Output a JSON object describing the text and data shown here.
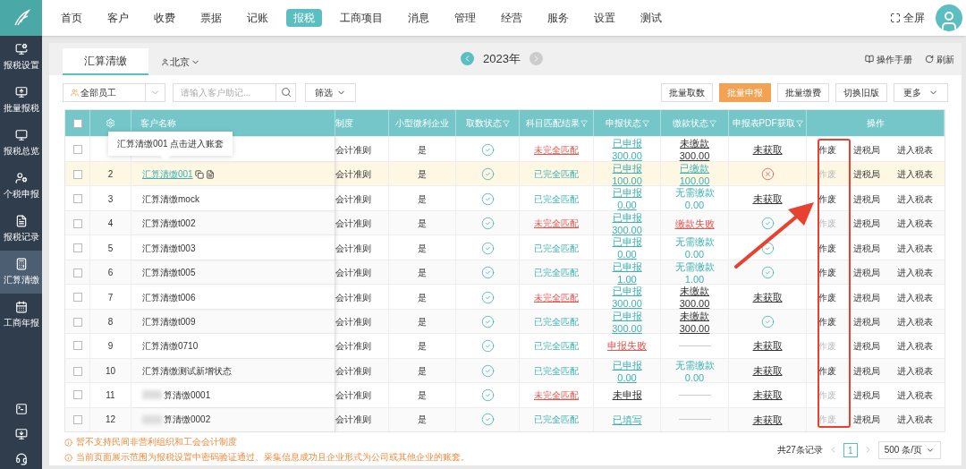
{
  "nav": {
    "items": [
      {
        "label": "首页",
        "selected": false
      },
      {
        "label": "客户",
        "selected": false
      },
      {
        "label": "收费",
        "selected": false
      },
      {
        "label": "票据",
        "selected": false
      },
      {
        "label": "记账",
        "selected": false
      },
      {
        "label": "报税",
        "selected": true
      },
      {
        "label": "工商项目",
        "selected": false
      },
      {
        "label": "消息",
        "selected": false
      },
      {
        "label": "管理",
        "selected": false
      },
      {
        "label": "经营",
        "selected": false
      },
      {
        "label": "服务",
        "selected": false
      },
      {
        "label": "设置",
        "selected": false
      },
      {
        "label": "测试",
        "selected": false
      }
    ],
    "fullscreen": "全屏"
  },
  "sidebar": {
    "items": [
      {
        "label": "报税设置",
        "selected": false
      },
      {
        "label": "批量报税",
        "selected": false
      },
      {
        "label": "报税总览",
        "selected": false
      },
      {
        "label": "个税申报",
        "selected": false
      },
      {
        "label": "报税记录",
        "selected": false
      },
      {
        "label": "汇算清缴",
        "selected": true
      },
      {
        "label": "工商年报",
        "selected": false
      }
    ]
  },
  "tabs": [
    {
      "label": "汇算清缴",
      "selected": true
    }
  ],
  "region": "北京",
  "year": "2023年",
  "links": [
    "操作手册",
    "刷新"
  ],
  "toolbar": {
    "staff": "全部员工",
    "search_placeholder": "请输入客户助记...",
    "filter": "筛选",
    "buttons": [
      {
        "label": "批量取数",
        "kind": "default"
      },
      {
        "label": "批量申报",
        "kind": "primary"
      },
      {
        "label": "批量缴费",
        "kind": "default"
      },
      {
        "label": "切换旧版",
        "kind": "default"
      },
      {
        "label": "更多",
        "kind": "menu"
      }
    ]
  },
  "table": {
    "columns": [
      "客户名称",
      "制度",
      "小型微利企业",
      "取数状态",
      "科目匹配结果",
      "申报状态",
      "缴款状态",
      "申报表PDF获取",
      "操作"
    ],
    "tooltip": "汇算清缴001 点击进入账套",
    "select_all_checked": false,
    "rows": [
      {
        "index": "",
        "name": "",
        "system": "会计准则",
        "small": "是",
        "match": {
          "text": "未完全匹配",
          "kind": "partial"
        },
        "declare": {
          "kind": "link",
          "text": "已申报",
          "amount": "300.00"
        },
        "pay": {
          "kind": "dark",
          "text": "未缴款",
          "amount": "300.00"
        },
        "pdf": {
          "kind": "text",
          "text": "未获取"
        },
        "actions": {
          "void": "作废",
          "void_disabled": false,
          "bureau": "进税局",
          "form": "进入税表"
        },
        "highlighted": false
      },
      {
        "index": "2",
        "name": "汇算清缴001",
        "system": "会计准则",
        "small": "是",
        "match": {
          "text": "已完全匹配",
          "kind": "full"
        },
        "declare": {
          "kind": "link",
          "text": "已申报",
          "amount": "100.00"
        },
        "pay": {
          "kind": "link",
          "text": "已缴款",
          "amount": "100.00"
        },
        "pdf": {
          "kind": "error"
        },
        "actions": {
          "void": "作废",
          "void_disabled": true,
          "bureau": "进税局",
          "form": "进入税表"
        },
        "highlighted": true,
        "masked": false
      },
      {
        "index": "3",
        "name": "汇算清缴mock",
        "system": "会计准则",
        "small": "是",
        "match": {
          "text": "已完全匹配",
          "kind": "full"
        },
        "declare": {
          "kind": "link",
          "text": "已申报",
          "amount": "0.00"
        },
        "pay": {
          "kind": "plain",
          "text": "无需缴款",
          "amount": "0.00"
        },
        "pdf": {
          "kind": "text",
          "text": "未获取"
        },
        "actions": {
          "void": "作废",
          "void_disabled": false,
          "bureau": "进税局",
          "form": "进入税表"
        },
        "highlighted": false,
        "masked": false
      },
      {
        "index": "4",
        "name": "汇算清缴t002",
        "system": "会计准则",
        "small": "是",
        "match": {
          "text": "未完全匹配",
          "kind": "partial"
        },
        "declare": {
          "kind": "link",
          "text": "已申报",
          "amount": "300.00"
        },
        "pay": {
          "kind": "danger",
          "text": "缴款失败"
        },
        "pdf": {
          "kind": "check"
        },
        "actions": {
          "void": "作废",
          "void_disabled": true,
          "bureau": "进税局",
          "form": "进入税表"
        },
        "highlighted": false,
        "masked": false
      },
      {
        "index": "5",
        "name": "汇算清缴t003",
        "system": "会计准则",
        "small": "是",
        "match": {
          "text": "已完全匹配",
          "kind": "full"
        },
        "declare": {
          "kind": "link",
          "text": "已申报",
          "amount": "0.00"
        },
        "pay": {
          "kind": "plain",
          "text": "无需缴款",
          "amount": "0.00"
        },
        "pdf": {
          "kind": "check"
        },
        "actions": {
          "void": "作废",
          "void_disabled": false,
          "bureau": "进税局",
          "form": "进入税表"
        },
        "highlighted": false,
        "masked": false
      },
      {
        "index": "6",
        "name": "汇算清缴t005",
        "system": "会计准则",
        "small": "是",
        "match": {
          "text": "已完全匹配",
          "kind": "full"
        },
        "declare": {
          "kind": "link",
          "text": "已申报",
          "amount": "1.00"
        },
        "pay": {
          "kind": "plain",
          "text": "无需缴款",
          "amount": "1.00"
        },
        "pdf": {
          "kind": "check"
        },
        "actions": {
          "void": "作废",
          "void_disabled": false,
          "bureau": "进税局",
          "form": "进入税表"
        },
        "highlighted": false,
        "masked": false
      },
      {
        "index": "7",
        "name": "汇算清缴t006",
        "system": "会计准则",
        "small": "是",
        "match": {
          "text": "未完全匹配",
          "kind": "partial"
        },
        "declare": {
          "kind": "link",
          "text": "已申报",
          "amount": "300.00"
        },
        "pay": {
          "kind": "dark",
          "text": "未缴款",
          "amount": "300.00"
        },
        "pdf": {
          "kind": "text",
          "text": "未获取"
        },
        "actions": {
          "void": "作废",
          "void_disabled": false,
          "bureau": "进税局",
          "form": "进入税表"
        },
        "highlighted": false,
        "masked": false
      },
      {
        "index": "8",
        "name": "汇算清缴t009",
        "system": "会计准则",
        "small": "是",
        "match": {
          "text": "已完全匹配",
          "kind": "full"
        },
        "declare": {
          "kind": "link",
          "text": "已申报",
          "amount": "300.00"
        },
        "pay": {
          "kind": "dark",
          "text": "未缴款",
          "amount": "300.00"
        },
        "pdf": {
          "kind": "check"
        },
        "actions": {
          "void": "作废",
          "void_disabled": false,
          "bureau": "进税局",
          "form": "进入税表"
        },
        "highlighted": false,
        "masked": false
      },
      {
        "index": "9",
        "name": "汇算清缴0710",
        "system": "会计准则",
        "small": "是",
        "match": {
          "text": "已完全匹配",
          "kind": "full"
        },
        "declare": {
          "kind": "danger",
          "text": "申报失败"
        },
        "pay": {
          "kind": "none"
        },
        "pdf": {
          "kind": "text",
          "text": "未获取"
        },
        "actions": {
          "void": "作废",
          "void_disabled": true,
          "bureau": "进税局",
          "form": "进入税表"
        },
        "highlighted": false,
        "masked": false
      },
      {
        "index": "10",
        "name": "汇算清缴测试新增状态",
        "system": "会计准则",
        "small": "是",
        "match": {
          "text": "已完全匹配",
          "kind": "full"
        },
        "declare": {
          "kind": "link",
          "text": "已申报",
          "amount": "0.00"
        },
        "pay": {
          "kind": "plain",
          "text": "无需缴款",
          "amount": "0.00"
        },
        "pdf": {
          "kind": "text",
          "text": "未获取"
        },
        "actions": {
          "void": "作废",
          "void_disabled": false,
          "bureau": "进税局",
          "form": "进入税表"
        },
        "highlighted": false,
        "masked": false
      },
      {
        "index": "11",
        "name": "算清缴0001",
        "system": "会计准则",
        "small": "是",
        "match": {
          "text": "未完全匹配",
          "kind": "partial"
        },
        "declare": {
          "kind": "dark",
          "text": "未申报"
        },
        "pay": {
          "kind": "none"
        },
        "pdf": {
          "kind": "text",
          "text": "未获取"
        },
        "actions": {
          "void": "作废",
          "void_disabled": true,
          "bureau": "进税局",
          "form": "进入税表"
        },
        "highlighted": false,
        "masked": true
      },
      {
        "index": "12",
        "name": "算清缴0002",
        "system": "会计准则",
        "small": "是",
        "match": {
          "text": "已完全匹配",
          "kind": "full"
        },
        "declare": {
          "kind": "link",
          "text": "已填写"
        },
        "pay": {
          "kind": "none"
        },
        "pdf": {
          "kind": "text",
          "text": "未获取"
        },
        "actions": {
          "void": "作废",
          "void_disabled": true,
          "bureau": "进税局",
          "form": "进入税表"
        },
        "highlighted": false,
        "masked": true
      }
    ]
  },
  "notes": [
    "暂不支持民间非营利组织和工会会计制度",
    "当前页面展示范围为报税设置中密码验证通过、采集信息成功且企业形式为公司或其他企业的账套。"
  ],
  "pagination": {
    "total": "共27条记录",
    "pages": [
      {
        "label": "1",
        "selected": true
      }
    ],
    "page_size": "500 条/页"
  },
  "annotation": {
    "highlight": true
  }
}
